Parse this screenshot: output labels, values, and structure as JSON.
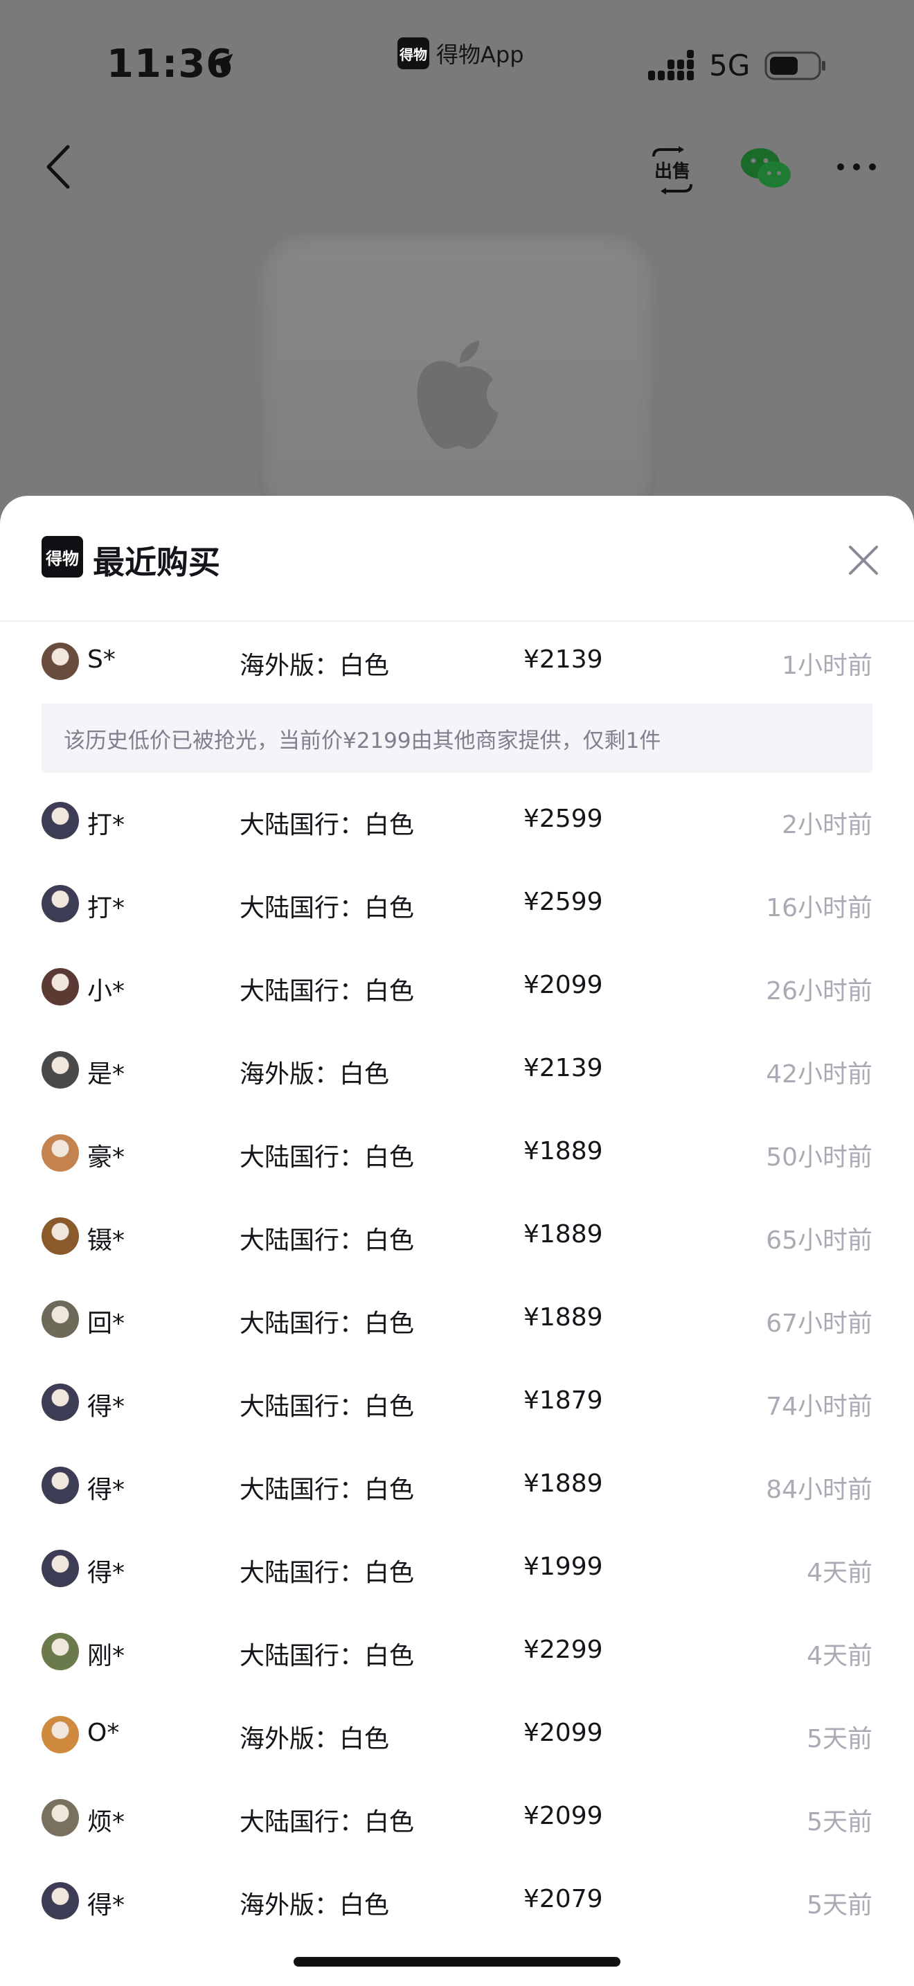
{
  "status_bar": {
    "time": "11:36",
    "app_label": "得物App",
    "app_badge": "得物",
    "network": "5G"
  },
  "nav": {
    "back_icon": "chevron-left-icon",
    "sell_icon": "sell-icon",
    "sell_label": "出售",
    "wechat_icon": "wechat-icon",
    "more_icon": "ellipsis-icon"
  },
  "sheet": {
    "logo_text": "得物",
    "title": "最近购买",
    "close_icon": "close-icon",
    "notice": "该历史低价已被抢光，当前价¥2199由其他商家提供，仅剩1件",
    "rows": [
      {
        "user": "S*",
        "variant": "海外版：白色",
        "price": "¥2139",
        "time": "1小时前",
        "avatar_color": "#6a4c3e"
      },
      {
        "user": "打*",
        "variant": "大陆国行：白色",
        "price": "¥2599",
        "time": "2小时前",
        "avatar_color": "#3c3c55"
      },
      {
        "user": "打*",
        "variant": "大陆国行：白色",
        "price": "¥2599",
        "time": "16小时前",
        "avatar_color": "#3c3c55"
      },
      {
        "user": "小*",
        "variant": "大陆国行：白色",
        "price": "¥2099",
        "time": "26小时前",
        "avatar_color": "#5b3a34"
      },
      {
        "user": "是*",
        "variant": "海外版：白色",
        "price": "¥2139",
        "time": "42小时前",
        "avatar_color": "#4a4a4a"
      },
      {
        "user": "豪*",
        "variant": "大陆国行：白色",
        "price": "¥1889",
        "time": "50小时前",
        "avatar_color": "#c4824e"
      },
      {
        "user": "镊*",
        "variant": "大陆国行：白色",
        "price": "¥1889",
        "time": "65小时前",
        "avatar_color": "#8a5a2a"
      },
      {
        "user": "回*",
        "variant": "大陆国行：白色",
        "price": "¥1889",
        "time": "67小时前",
        "avatar_color": "#6d6a5a"
      },
      {
        "user": "得*",
        "variant": "大陆国行：白色",
        "price": "¥1879",
        "time": "74小时前",
        "avatar_color": "#3c3c55"
      },
      {
        "user": "得*",
        "variant": "大陆国行：白色",
        "price": "¥1889",
        "time": "84小时前",
        "avatar_color": "#3c3c55"
      },
      {
        "user": "得*",
        "variant": "大陆国行：白色",
        "price": "¥1999",
        "time": "4天前",
        "avatar_color": "#3c3c55"
      },
      {
        "user": "刚*",
        "variant": "大陆国行：白色",
        "price": "¥2299",
        "time": "4天前",
        "avatar_color": "#6b7a4a"
      },
      {
        "user": "O*",
        "variant": "海外版：白色",
        "price": "¥2099",
        "time": "5天前",
        "avatar_color": "#d08a40"
      },
      {
        "user": "烦*",
        "variant": "大陆国行：白色",
        "price": "¥2099",
        "time": "5天前",
        "avatar_color": "#7a7060"
      },
      {
        "user": "得*",
        "variant": "海外版：白色",
        "price": "¥2079",
        "time": "5天前",
        "avatar_color": "#3c3c55"
      }
    ]
  }
}
